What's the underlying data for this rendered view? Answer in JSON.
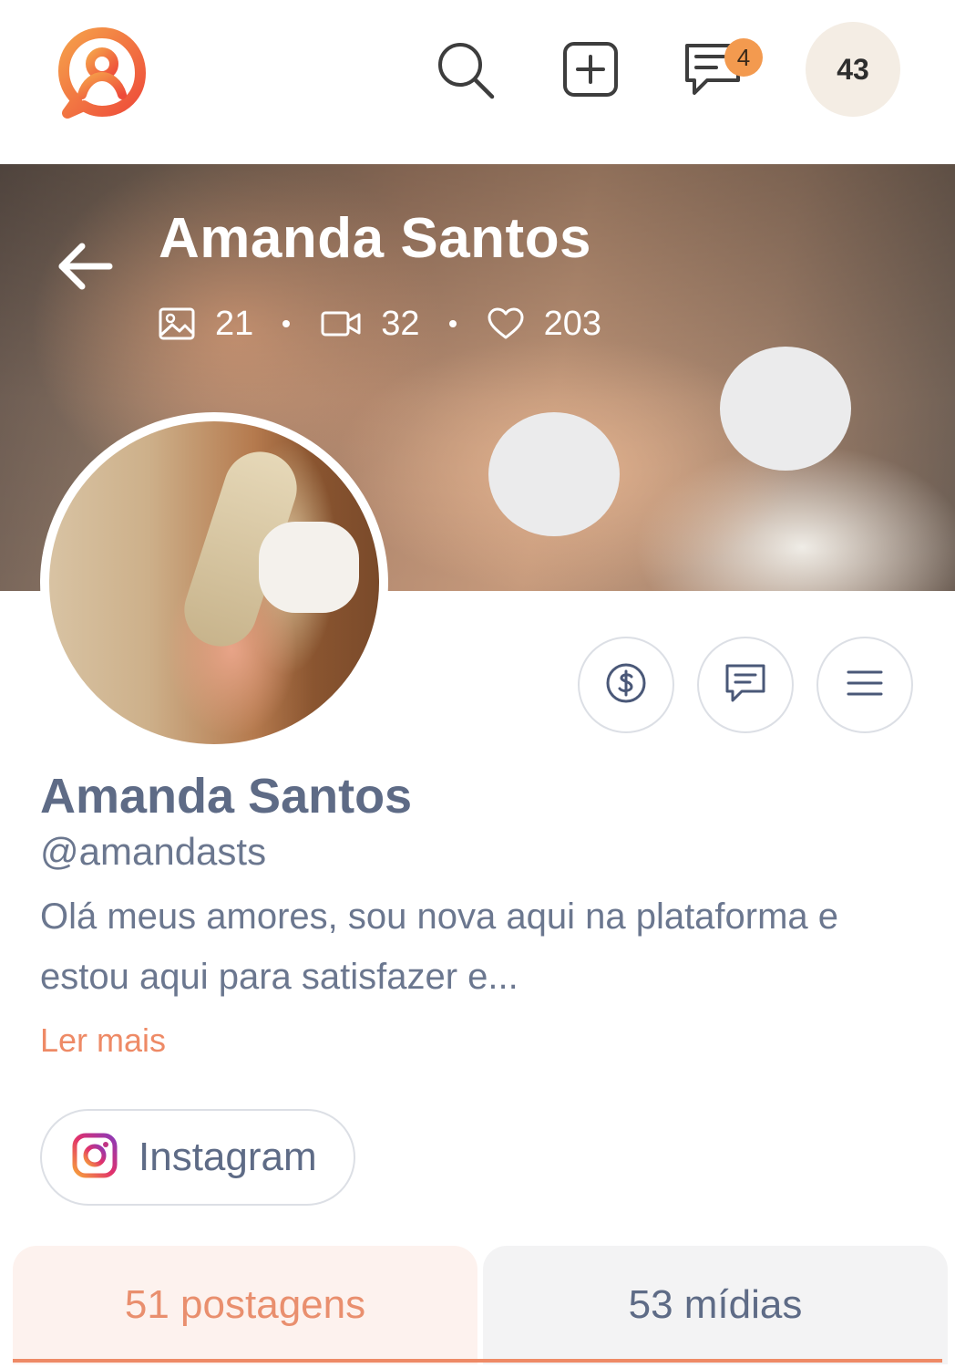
{
  "header": {
    "logo_icon": "app-logo-icon",
    "search_icon": "search-icon",
    "create_icon": "plus-square-icon",
    "messages_icon": "message-icon",
    "messages_badge": "4",
    "account_badge": "43",
    "brand_color": "#f26d3d"
  },
  "cover": {
    "back_icon": "arrow-left-icon",
    "name": "Amanda Santos",
    "stats": {
      "photos": "21",
      "videos": "32",
      "likes": "203"
    }
  },
  "actions": {
    "tip_icon": "dollar-icon",
    "chat_icon": "chat-icon",
    "menu_icon": "menu-icon"
  },
  "profile": {
    "name": "Amanda Santos",
    "handle": "@amandasts",
    "bio": "Olá meus amores, sou nova aqui na plataforma e estou aqui para satisfazer e...",
    "read_more": "Ler mais"
  },
  "social": {
    "instagram_label": "Instagram",
    "instagram_icon": "instagram-icon"
  },
  "tabs": [
    {
      "label": "51 postagens",
      "active": true
    },
    {
      "label": "53 mídias",
      "active": false
    }
  ],
  "colors": {
    "accent": "#ee8a66",
    "text": "#5e6b86",
    "badge": "#f39a4f"
  }
}
